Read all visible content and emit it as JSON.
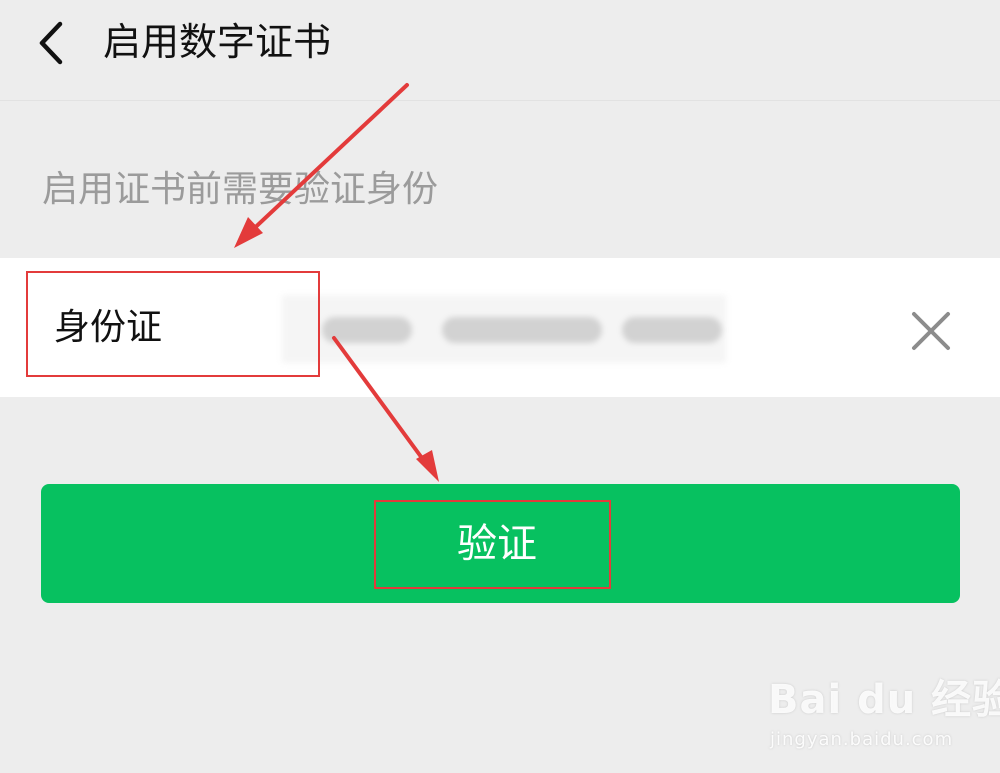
{
  "header": {
    "title": "启用数字证书",
    "back_icon": "chevron-left-icon"
  },
  "form": {
    "hint": "启用证书前需要验证身份",
    "id_label": "身份证",
    "clear_icon": "close-icon"
  },
  "verify_button": {
    "label": "验证",
    "color": "#07c160"
  },
  "annotation": {
    "color": "#e33b3b"
  },
  "watermark": {
    "logo": "Bai du 经验",
    "url": "jingyan.baidu.com"
  }
}
